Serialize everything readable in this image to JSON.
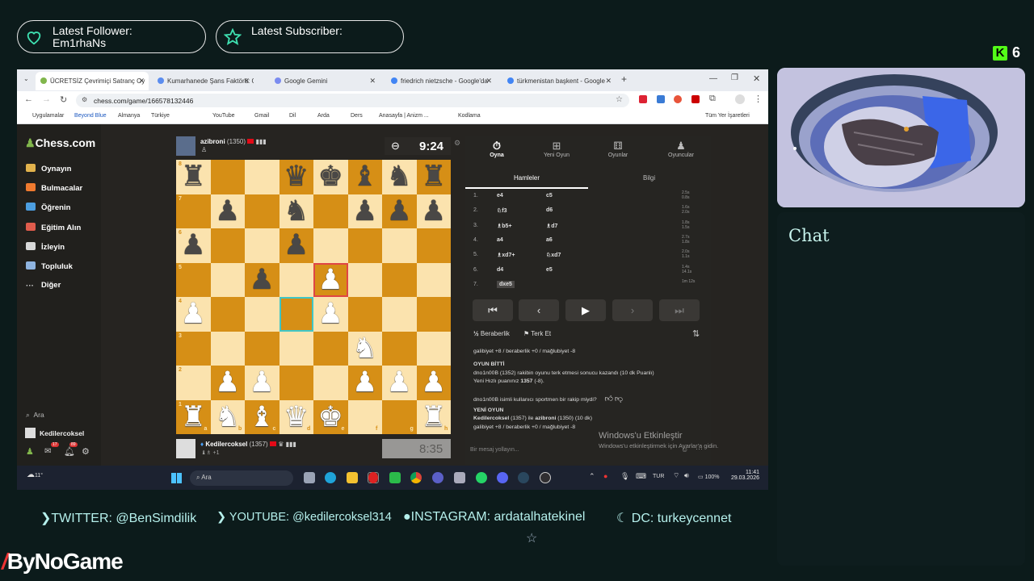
{
  "overlay": {
    "latest_follower_label": "Latest Follower:",
    "latest_follower_name": "Em1rhaNs",
    "latest_subscriber_label": "Latest Subscriber:",
    "kick_count": "6",
    "chat_title": "Chat",
    "socials": {
      "twitter": "TWITTER: @BenSimdilik",
      "youtube": "YOUTUBE: @kedilercoksel314",
      "instagram": "INSTAGRAM: ardatalhatekinel",
      "discord": "DC: turkeycennet"
    },
    "brand": "ByNoGame"
  },
  "browser": {
    "tabs": [
      {
        "label": "ÜCRETSİZ Çevrimiçi Satranç Oy",
        "color": "#81b64c"
      },
      {
        "label": "Kumarhanede Şans Faktörü: Ol",
        "color": "#5b8def"
      },
      {
        "label": "Google Gemini",
        "color": "#7b8cf0"
      },
      {
        "label": "friedrich nietzsche - Google'da",
        "color": "#4285f4"
      },
      {
        "label": "türkmenistan başkent - Google",
        "color": "#4285f4"
      }
    ],
    "url": "chess.com/game/166578132446",
    "bookmarks": [
      "Uygulamalar",
      "Beyond Blue",
      "Almanya",
      "Türkiye",
      "YouTube",
      "Gmail",
      "Dil",
      "Arda",
      "Ders",
      "Anasayfa | Anizm ...",
      "Kodlama",
      "Tüm Yer İşaretleri"
    ]
  },
  "sidebar": {
    "logo": "Chess.com",
    "items": [
      "Oynayın",
      "Bulmacalar",
      "Öğrenin",
      "Eğitim Alın",
      "İzleyin",
      "Topluluk",
      "Diğer"
    ],
    "search": "Ara",
    "user": "Kedilercoksel",
    "badges": [
      "17",
      "89"
    ]
  },
  "game": {
    "opponent": {
      "name": "azibroni",
      "rating": "(1350)",
      "clock": "9:24"
    },
    "player": {
      "name": "Kedilercoksel",
      "rating": "(1357)",
      "clock": "8:35",
      "material": "+1"
    },
    "ranks": [
      "8",
      "7",
      "6",
      "5",
      "4",
      "3",
      "2",
      "1"
    ],
    "files": [
      "a",
      "b",
      "c",
      "d",
      "e",
      "f",
      "g",
      "h"
    ]
  },
  "panel": {
    "tabs": [
      "Oyna",
      "Yeni Oyun",
      "Oyunlar",
      "Oyuncular"
    ],
    "subtabs": [
      "Hamleler",
      "Bilgi"
    ],
    "moves": [
      {
        "n": "1.",
        "w": "e4",
        "b": "c5",
        "t1": "2.5s",
        "t2": "0.8s"
      },
      {
        "n": "2.",
        "w": "♘f3",
        "b": "d6",
        "t1": "1.6s",
        "t2": "2.0s"
      },
      {
        "n": "3.",
        "w": "♗b5+",
        "b": "♗d7",
        "t1": "1.8s",
        "t2": "1.5s"
      },
      {
        "n": "4.",
        "w": "a4",
        "b": "a6",
        "t1": "2.7s",
        "t2": "1.8s"
      },
      {
        "n": "5.",
        "w": "♗xd7+",
        "b": "♘xd7",
        "t1": "2.0s",
        "t2": "1.1s"
      },
      {
        "n": "6.",
        "w": "d4",
        "b": "e5",
        "t1": "1.4s",
        "t2": "14.1s"
      },
      {
        "n": "7.",
        "w": "dxe5",
        "b": "",
        "t1": "1m 12s",
        "t2": ""
      }
    ],
    "draw": "Beraberlik",
    "resign": "Terk Et",
    "log": {
      "line1": "galibiyet +8 / beraberlik +0 / mağlubiyet -8",
      "over": "OYUN BİTTİ",
      "result": "dno1n00B (1352) rakibin oyunu terk etmesi sonucu kazandı (10 dk Puanlı)",
      "rating_prefix": "Yeni Hızlı puanınız",
      "rating_value": "1357",
      "rating_delta": "(-8).",
      "ask": "dno1n00B isimli kullanıcı sportmen bir rakip miydi?",
      "new": "YENİ OYUN",
      "match_a": "Kedilercoksel",
      "match_mid": "(1357) ile",
      "match_b": "azibroni",
      "match_end": "(1350) (10 dk)",
      "line2": "galibiyet +8 / beraberlik +0 / mağlubiyet -8"
    },
    "placeholder": "Bir mesaj yollayın...",
    "activate_title": "Windows'u Etkinleştir",
    "activate_sub": "Windows'u etkinleştirmek için Ayarlar'a gidin."
  },
  "taskbar": {
    "weather": "11°",
    "search": "Ara",
    "lang": "TUR",
    "battery": "100%",
    "time": "11:41",
    "date": "29.03.2026"
  }
}
